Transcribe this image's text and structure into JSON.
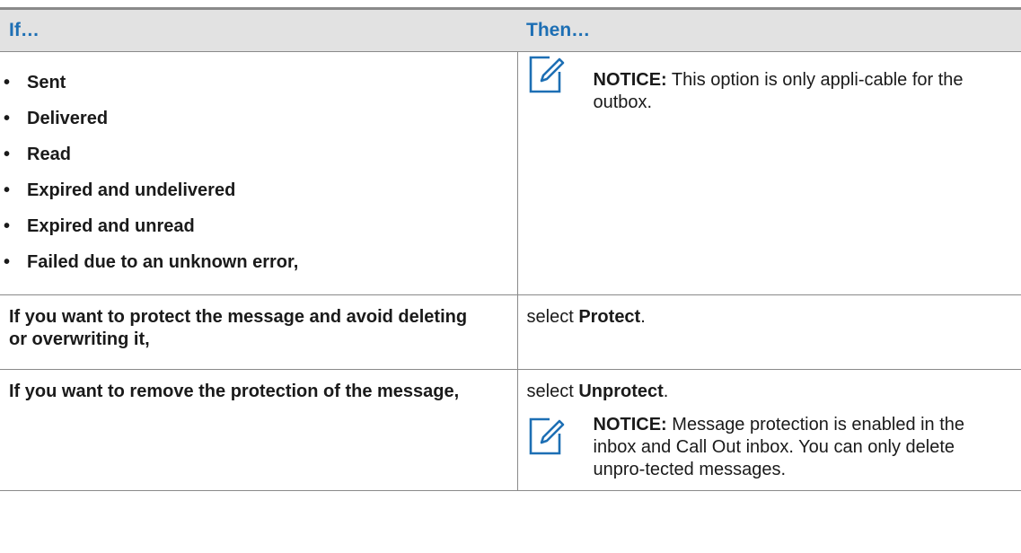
{
  "table": {
    "headers": {
      "if": "If…",
      "then": "Then…"
    },
    "row1": {
      "bullets": [
        "Sent",
        "Delivered",
        "Read",
        "Expired and undelivered",
        "Expired and unread",
        "Failed due to an unknown error,"
      ],
      "bullet_char": "•",
      "notice_label": "NOTICE:",
      "notice_text": "This option is only appli-cable for the outbox."
    },
    "row2": {
      "if_text": "If you want to protect the message and avoid deleting or overwriting it,",
      "then_prefix": "select",
      "then_bold": "Protect",
      "then_suffix": "."
    },
    "row3": {
      "if_text": "If you want to remove the protection of the message,",
      "then_prefix": "select",
      "then_bold": "Unprotect",
      "then_suffix": ".",
      "notice_label": "NOTICE:",
      "notice_text": "Message protection is enabled in the inbox and Call Out inbox. You can only delete unpro-tected messages."
    }
  },
  "colors": {
    "header_text": "#1d6fb4",
    "header_bg": "#e2e2e2",
    "border": "#8a8a8a",
    "icon": "#1d6fb4"
  },
  "icons": {
    "notice": "note-edit-icon"
  }
}
